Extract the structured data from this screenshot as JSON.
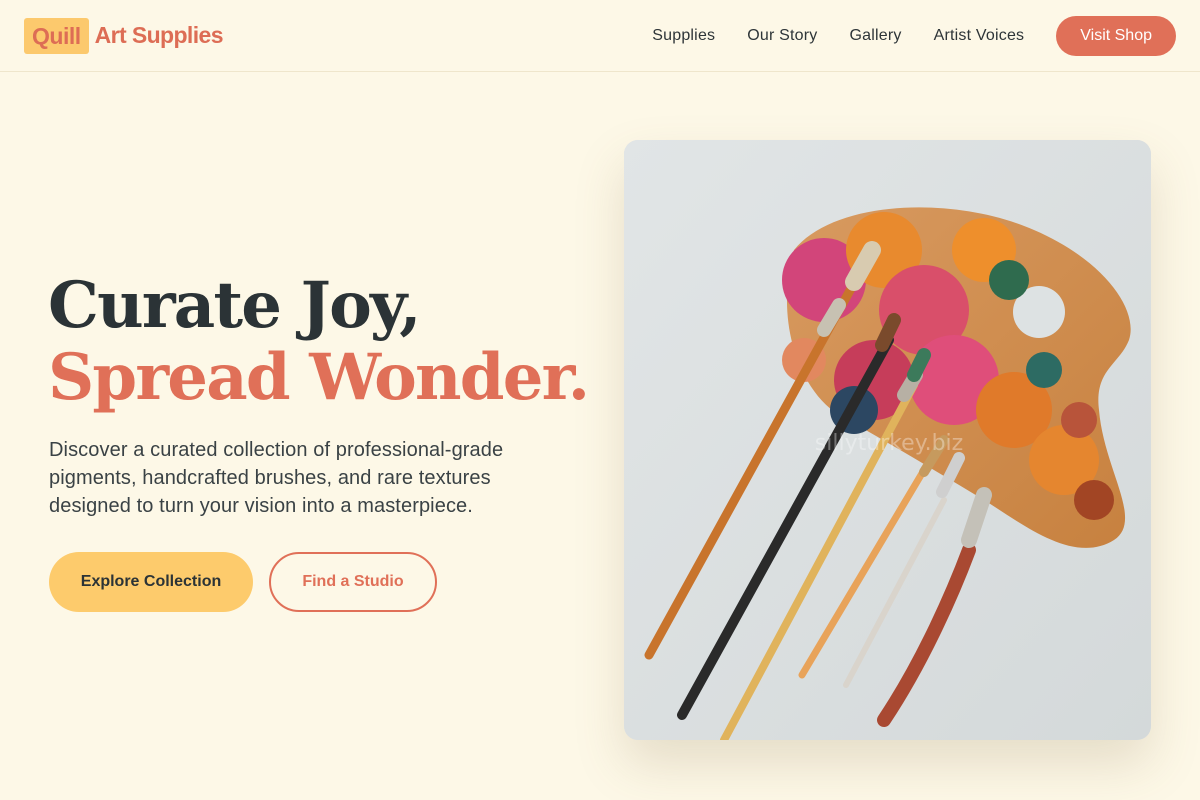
{
  "header": {
    "logo_mark": "Quill",
    "logo_text": "Art Supplies",
    "nav": [
      {
        "label": "Supplies"
      },
      {
        "label": "Our Story"
      },
      {
        "label": "Gallery"
      },
      {
        "label": "Artist Voices"
      }
    ],
    "shop_button": "Visit Shop"
  },
  "hero": {
    "title_line1": "Curate Joy,",
    "title_line2": "Spread Wonder.",
    "description": "Discover a curated collection of professional-grade pigments, handcrafted brushes, and rare textures designed to turn your vision into a masterpiece.",
    "primary_button": "Explore Collection",
    "secondary_button": "Find a Studio"
  },
  "colors": {
    "background": "#fdf8e7",
    "accent": "#e07058",
    "highlight": "#fdcb6c",
    "text": "#2b3336"
  },
  "image": {
    "subject": "painter's palette with paint brushes",
    "watermark": "sillyturkey.biz"
  }
}
